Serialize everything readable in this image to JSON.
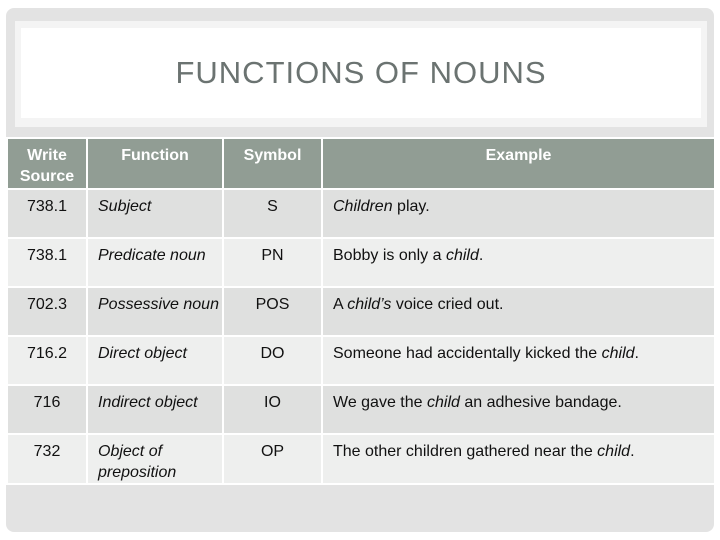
{
  "slide": {
    "title": "FUNCTIONS OF NOUNS"
  },
  "table": {
    "headers": {
      "write_source": "Write Source",
      "function": "Function",
      "symbol": "Symbol",
      "example": "Example"
    },
    "rows": [
      {
        "source": "738.1",
        "function": "Subject",
        "symbol": "S",
        "example": {
          "pre": "",
          "em": "Children",
          "post": " play."
        }
      },
      {
        "source": "738.1",
        "function": "Predicate noun",
        "symbol": "PN",
        "example": {
          "pre": "Bobby is only a ",
          "em": "child",
          "post": "."
        }
      },
      {
        "source": "702.3",
        "function": "Possessive noun",
        "symbol": "POS",
        "example": {
          "pre": "A ",
          "em": "child’s",
          "post": " voice cried out."
        }
      },
      {
        "source": "716.2",
        "function": "Direct object",
        "symbol": "DO",
        "example": {
          "pre": "Someone had accidentally kicked the ",
          "em": "child",
          "post": "."
        }
      },
      {
        "source": "716",
        "function": "Indirect object",
        "symbol": "IO",
        "example": {
          "pre": "We gave the ",
          "em": "child",
          "post": " an adhesive bandage."
        }
      },
      {
        "source": "732",
        "function": "Object of preposition",
        "symbol": "OP",
        "example": {
          "pre": "The other children gathered near the ",
          "em": "child",
          "post": "."
        }
      }
    ]
  },
  "colors": {
    "header_bg": "#919d94",
    "row_odd_bg": "#dfe0df",
    "row_even_bg": "#eeefee",
    "title_color": "#6b7371",
    "frame_bg": "#e3e3e3"
  }
}
